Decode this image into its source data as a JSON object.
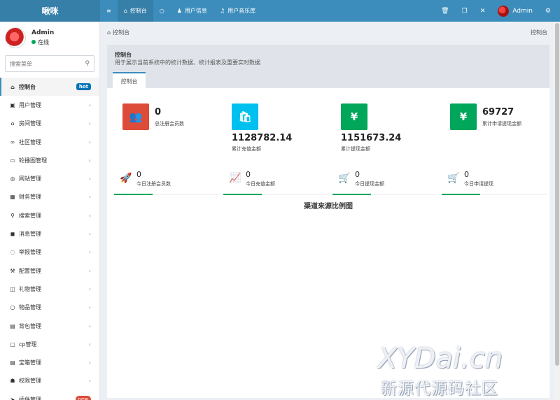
{
  "brand": "啾咪",
  "topnav": {
    "items": [
      {
        "icon": "≡",
        "label": ""
      },
      {
        "icon": "⌂",
        "label": "控制台"
      },
      {
        "icon": "○",
        "label": ""
      },
      {
        "icon": "♟",
        "label": "用户信息"
      },
      {
        "icon": "♫",
        "label": "用户音乐库"
      }
    ],
    "right": {
      "user": "Admin"
    }
  },
  "user": {
    "name": "Admin",
    "status": "在线"
  },
  "search": {
    "placeholder": "搜索菜单"
  },
  "sidebar": {
    "items": [
      {
        "icon": "⌂",
        "label": "控制台",
        "badge": "hot"
      },
      {
        "icon": "▣",
        "label": "用户管理"
      },
      {
        "icon": "⌂",
        "label": "房间管理"
      },
      {
        "icon": "∞",
        "label": "社区管理"
      },
      {
        "icon": "▭",
        "label": "轮播图管理"
      },
      {
        "icon": "◎",
        "label": "网站管理"
      },
      {
        "icon": "▦",
        "label": "财务管理"
      },
      {
        "icon": "⚲",
        "label": "搜索管理"
      },
      {
        "icon": "◼",
        "label": "消息管理"
      },
      {
        "icon": "◌",
        "label": "举报管理"
      },
      {
        "icon": "⚒",
        "label": "配置管理"
      },
      {
        "icon": "◫",
        "label": "礼物管理"
      },
      {
        "icon": "○",
        "label": "物品管理"
      },
      {
        "icon": "▤",
        "label": "背包管理"
      },
      {
        "icon": "▢",
        "label": "cp管理"
      },
      {
        "icon": "▤",
        "label": "宝箱管理"
      },
      {
        "icon": "☗",
        "label": "权限管理"
      },
      {
        "icon": "➤",
        "label": "插件管理",
        "badge": "new"
      }
    ]
  },
  "breadcrumb": {
    "left": "控制台",
    "right": "控制台"
  },
  "page": {
    "title": "控制台",
    "desc": "用于展示当前系统中的统计数据、统计报表及重要实时数据",
    "tab": "控制台"
  },
  "stats": [
    {
      "icon": "👥",
      "value": "0",
      "label": "总注册会员数",
      "color": "#dd4b39"
    },
    {
      "icon": "🛍",
      "value": "1128782.14",
      "label": "累计充值金额",
      "color": "#00c0ef"
    },
    {
      "icon": "¥",
      "value": "1151673.24",
      "label": "累计提现金额",
      "color": "#00a65a"
    },
    {
      "icon": "¥",
      "value": "69727",
      "label": "累计申请提现金额",
      "color": "#00a65a"
    }
  ],
  "mini_stats": [
    {
      "icon": "🚀",
      "value": "0",
      "label": "今日注册会员数"
    },
    {
      "icon": "📈",
      "value": "0",
      "label": "今日充值金额"
    },
    {
      "icon": "🛒",
      "value": "0",
      "label": "今日提现金额"
    },
    {
      "icon": "🛒",
      "value": "0",
      "label": "今日申请提现"
    }
  ],
  "section_title": "渠道来源比例图",
  "watermark": {
    "line1": "XYDai.cn",
    "line2": "新源代源码社区"
  }
}
